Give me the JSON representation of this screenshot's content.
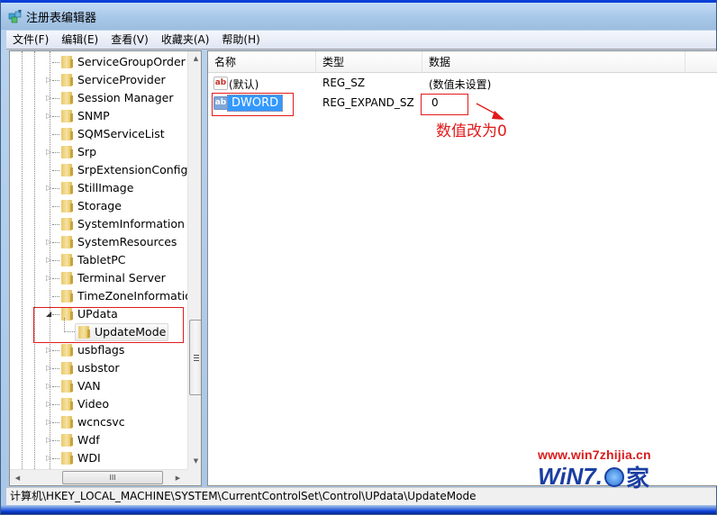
{
  "window": {
    "title": "注册表编辑器"
  },
  "menu": [
    "文件(F)",
    "编辑(E)",
    "查看(V)",
    "收藏夹(A)",
    "帮助(H)"
  ],
  "tree": {
    "items": [
      {
        "label": "ServiceGroupOrder",
        "expandable": false
      },
      {
        "label": "ServiceProvider",
        "expandable": true
      },
      {
        "label": "Session Manager",
        "expandable": true
      },
      {
        "label": "SNMP",
        "expandable": true
      },
      {
        "label": "SQMServiceList",
        "expandable": false
      },
      {
        "label": "Srp",
        "expandable": true
      },
      {
        "label": "SrpExtensionConfig",
        "expandable": false
      },
      {
        "label": "StillImage",
        "expandable": true
      },
      {
        "label": "Storage",
        "expandable": false
      },
      {
        "label": "SystemInformation",
        "expandable": false
      },
      {
        "label": "SystemResources",
        "expandable": true
      },
      {
        "label": "TabletPC",
        "expandable": true
      },
      {
        "label": "Terminal Server",
        "expandable": true
      },
      {
        "label": "TimeZoneInformation",
        "expandable": false
      },
      {
        "label": "UPdata",
        "expandable": true,
        "expanded": true
      },
      {
        "label": "UpdateMode",
        "child": true,
        "selected": true
      },
      {
        "label": "usbflags",
        "expandable": true
      },
      {
        "label": "usbstor",
        "expandable": true
      },
      {
        "label": "VAN",
        "expandable": true
      },
      {
        "label": "Video",
        "expandable": true
      },
      {
        "label": "wcncsvc",
        "expandable": true
      },
      {
        "label": "Wdf",
        "expandable": true
      },
      {
        "label": "WDI",
        "expandable": true
      }
    ],
    "hscroll_grip": "III"
  },
  "list": {
    "columns": [
      "名称",
      "类型",
      "数据"
    ],
    "rows": [
      {
        "name": "(默认)",
        "type": "REG_SZ",
        "data": "(数值未设置)",
        "icon": "string-value-icon"
      },
      {
        "name": "DWORD",
        "type": "REG_EXPAND_SZ",
        "data": "0",
        "icon": "string-value-icon",
        "selected": true
      }
    ]
  },
  "annotation": {
    "text": "数值改为0",
    "color": "#e21a1a"
  },
  "status": {
    "path": "计算机\\HKEY_LOCAL_MACHINE\\SYSTEM\\CurrentControlSet\\Control\\UPdata\\UpdateMode"
  },
  "watermark": {
    "url": "www.win7zhijia.cn",
    "logo_text": "WiN7.",
    "logo_suffix": "家"
  }
}
